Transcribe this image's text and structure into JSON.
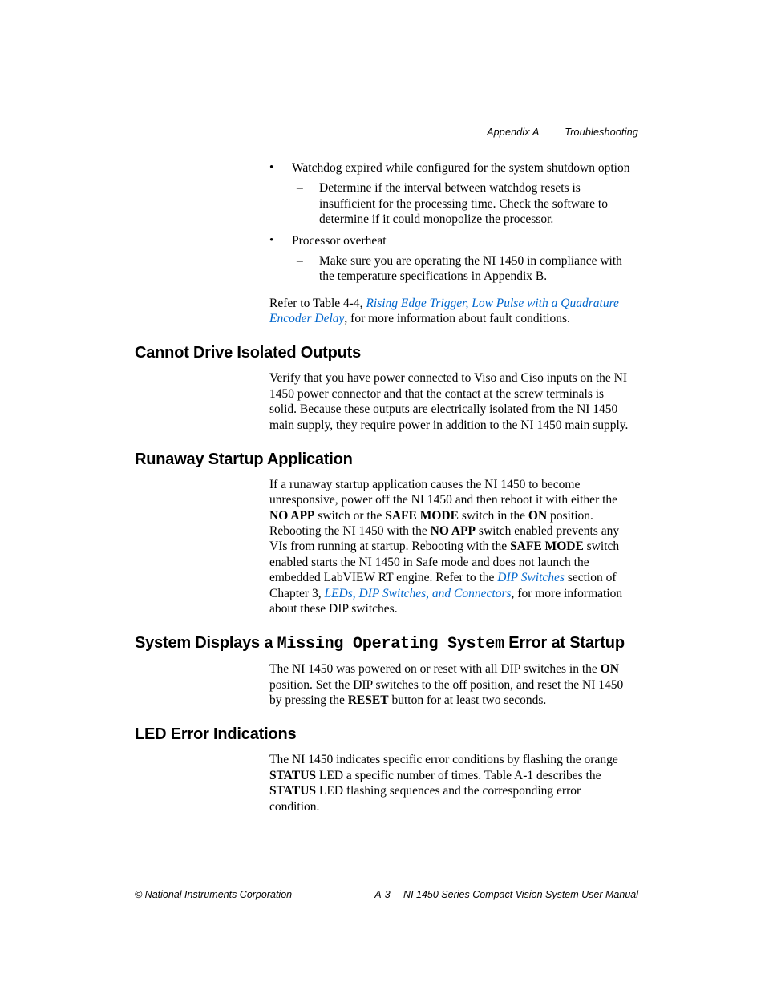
{
  "header": {
    "appendix": "Appendix A",
    "title": "Troubleshooting"
  },
  "bullets": [
    {
      "text": "Watchdog expired while configured for the system shutdown option",
      "sub": [
        "Determine if the interval between watchdog resets is insufficient for the processing time. Check the software to determine if it could monopolize the processor."
      ]
    },
    {
      "text": "Processor overheat",
      "sub": [
        "Make sure you are operating the NI 1450 in compliance with the temperature specifications in Appendix B."
      ]
    }
  ],
  "refer": {
    "pre": "Refer to Table 4-4, ",
    "link": "Rising Edge Trigger, Low Pulse with a Quadrature Encoder Delay",
    "post": ", for more information about fault conditions."
  },
  "sections": {
    "s1": {
      "title": "Cannot Drive Isolated Outputs",
      "body": "Verify that you have power connected to Viso and Ciso inputs on the NI 1450 power connector and that the contact at the screw terminals is solid. Because these outputs are electrically isolated from the NI 1450 main supply, they require power in addition to the NI 1450 main supply."
    },
    "s2": {
      "title": "Runaway Startup Application",
      "body_parts": {
        "p1": "If a runaway startup application causes the NI 1450 to become unresponsive, power off the NI 1450 and then reboot it with either the ",
        "b1": "NO APP",
        "p2": " switch or the ",
        "b2": "SAFE MODE",
        "p3": " switch in the ",
        "b3": "ON",
        "p4": " position. Rebooting the NI 1450 with the ",
        "b4": "NO APP",
        "p5": " switch enabled prevents any VIs from running at startup. Rebooting with the ",
        "b5": "SAFE MODE",
        "p6": " switch enabled starts the NI 1450 in Safe mode and does not launch the embedded LabVIEW RT engine. Refer to the ",
        "link1": "DIP Switches",
        "p7": " section of Chapter 3, ",
        "link2": "LEDs, DIP Switches, and Connectors",
        "p8": ", for more information about these DIP switches."
      }
    },
    "s3": {
      "title_pre": "System Displays a ",
      "title_mono": "Missing Operating System",
      "title_post": " Error at Startup",
      "body_parts": {
        "p1": "The NI 1450 was powered on or reset with all DIP switches in the ",
        "b1": "ON",
        "p2": " position. Set the DIP switches to the off position, and reset the NI 1450 by pressing the ",
        "b2": "RESET",
        "p3": " button for at least two seconds."
      }
    },
    "s4": {
      "title": "LED Error Indications",
      "body_parts": {
        "p1": "The NI 1450 indicates specific error conditions by flashing the orange ",
        "b1": "STATUS",
        "p2": " LED a specific number of times. Table A-1 describes the ",
        "b2": "STATUS",
        "p3": " LED flashing sequences and the corresponding error condition."
      }
    }
  },
  "footer": {
    "left": "© National Instruments Corporation",
    "center": "A-3",
    "right": "NI 1450 Series Compact Vision System User Manual"
  }
}
